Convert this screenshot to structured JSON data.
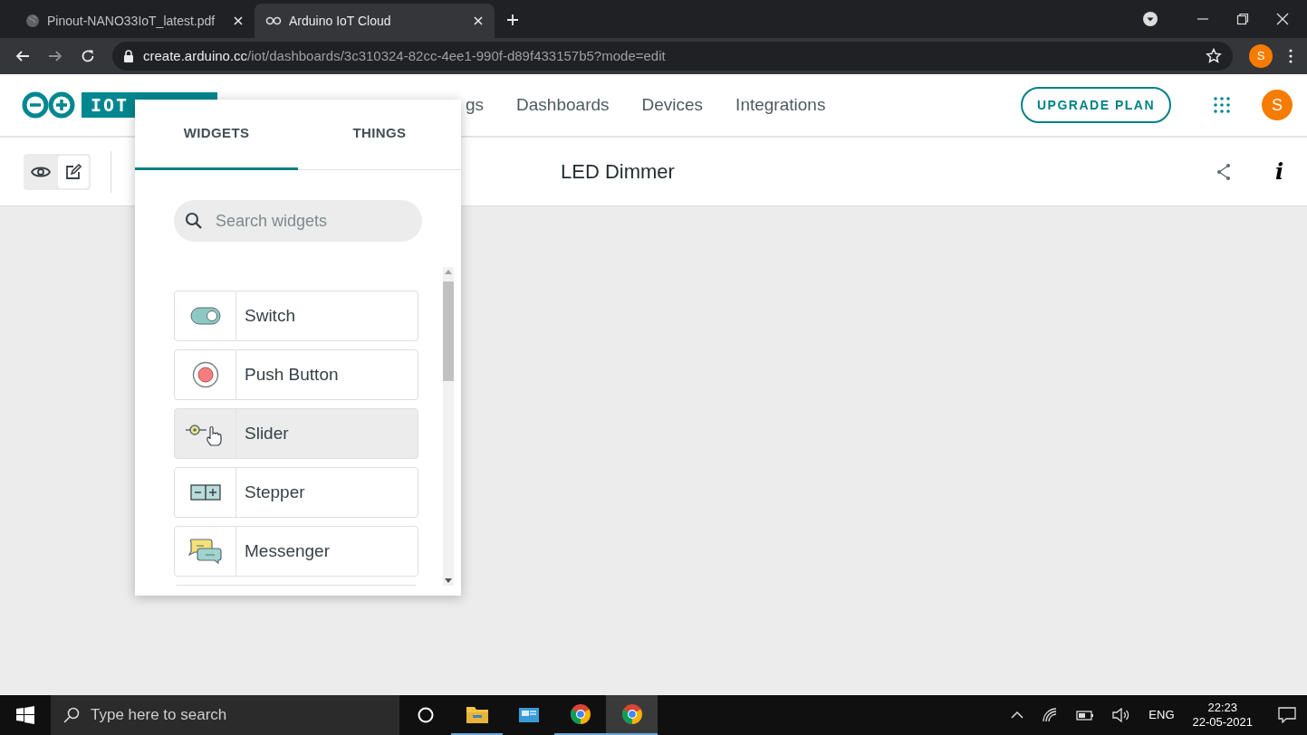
{
  "browser": {
    "tabs": [
      {
        "title": "Pinout-NANO33IoT_latest.pdf",
        "selected": false
      },
      {
        "title": "Arduino IoT Cloud",
        "selected": true
      }
    ],
    "url_host": "create.arduino.cc",
    "url_path": "/iot/dashboards/3c310324-82cc-4ee1-990f-d89f433157b5?mode=edit",
    "profile": "S"
  },
  "header": {
    "logo_text": "IOT",
    "nav": [
      "gs",
      "Dashboards",
      "Devices",
      "Integrations"
    ],
    "upgrade": "UPGRADE PLAN",
    "avatar": "S"
  },
  "toolbar": {
    "title": "LED Dimmer",
    "modes": [
      {
        "kind": "view",
        "selected": false
      },
      {
        "kind": "edit",
        "selected": true
      }
    ],
    "info": "i"
  },
  "panel": {
    "tabs": [
      {
        "label": "WIDGETS",
        "selected": true
      },
      {
        "label": "THINGS",
        "selected": false
      }
    ],
    "search": {
      "placeholder": "Search widgets"
    },
    "widgets": [
      {
        "kind": "switch",
        "label": "Switch",
        "highlighted": false
      },
      {
        "kind": "push",
        "label": "Push Button",
        "highlighted": false
      },
      {
        "kind": "slider",
        "label": "Slider",
        "highlighted": true
      },
      {
        "kind": "stepper",
        "label": "Stepper",
        "highlighted": false
      },
      {
        "kind": "messenger",
        "label": "Messenger",
        "highlighted": false
      }
    ]
  },
  "taskbar": {
    "search_placeholder": "Type here to search",
    "language": "ENG",
    "time": "22:23",
    "date": "22-05-2021"
  }
}
